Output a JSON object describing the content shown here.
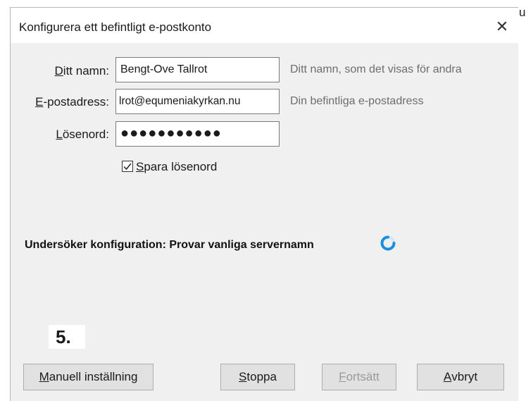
{
  "dialog": {
    "title": "Konfigurera ett befintligt e-postkonto",
    "close_glyph": "✕"
  },
  "background_text": "u",
  "form": {
    "name": {
      "label_accel": "D",
      "label_rest": "itt namn:",
      "value": "Bengt-Ove Tallrot",
      "hint": "Ditt namn, som det visas för andra"
    },
    "email": {
      "label_accel": "E",
      "label_rest": "-postadress:",
      "value": "lrot@equmeniakyrkan.nu",
      "hint": "Din befintliga e-postadress"
    },
    "password": {
      "label_pre": "",
      "label_accel": "L",
      "label_rest": "ösenord:",
      "value": "●●●●●●●●●●●"
    },
    "remember": {
      "checked": true,
      "label_accel": "S",
      "label_rest": "para lösenord"
    }
  },
  "status": {
    "text": "Undersöker konfiguration: Provar vanliga servernamn"
  },
  "step_marker": "5.",
  "buttons": {
    "manual": {
      "label_accel": "M",
      "label_rest": "anuell inställning"
    },
    "stop": {
      "label_accel": "S",
      "label_rest": "toppa"
    },
    "continue": {
      "label_accel": "F",
      "label_rest": "ortsätt",
      "disabled": true
    },
    "cancel": {
      "label_accel": "A",
      "label_rest": "vbryt"
    }
  },
  "colors": {
    "spinner": "#1a8fe0",
    "dialog_bg": "#f0f0f0",
    "hint_text": "#6d6d6d"
  }
}
